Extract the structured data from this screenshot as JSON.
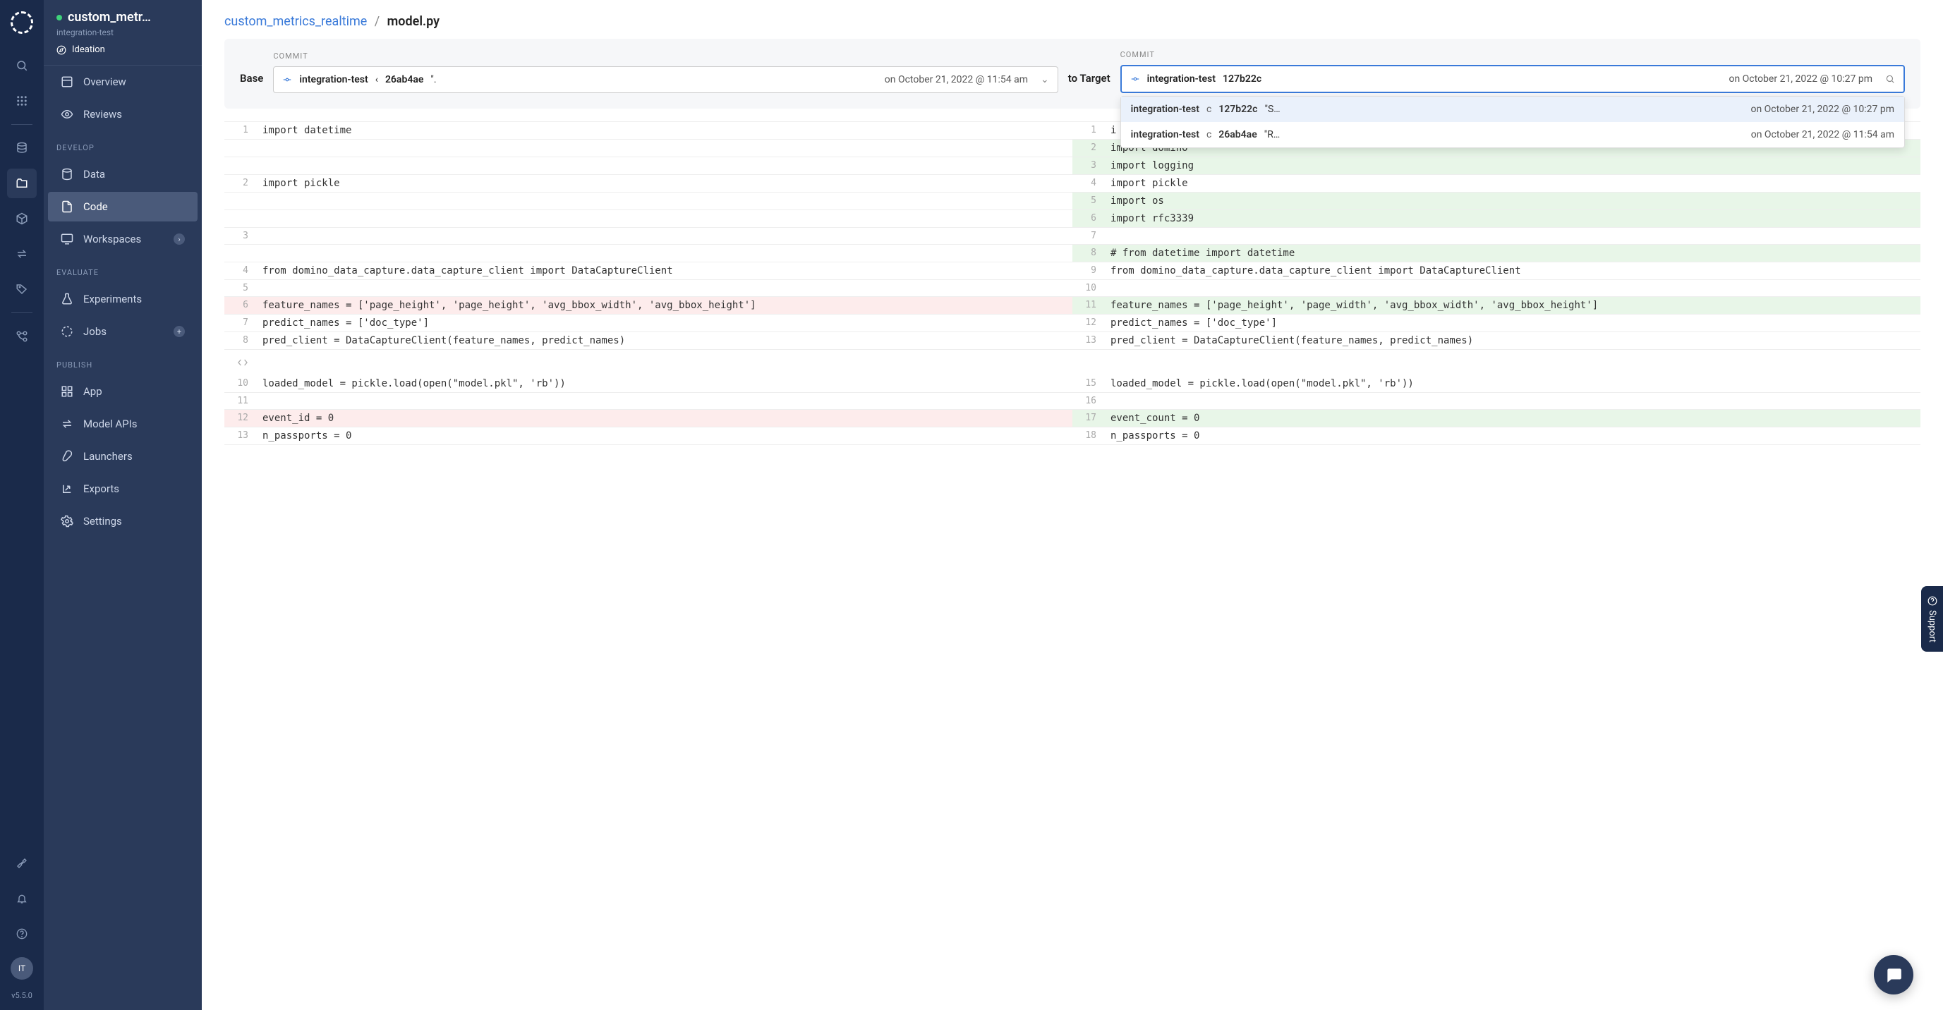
{
  "version": "v5.5.0",
  "avatar_initials": "IT",
  "project": {
    "title": "custom_metr…",
    "subtitle": "integration-test",
    "phase": "Ideation"
  },
  "sidebar": {
    "items": {
      "overview": "Overview",
      "reviews": "Reviews",
      "data": "Data",
      "code": "Code",
      "workspaces": "Workspaces",
      "experiments": "Experiments",
      "jobs": "Jobs",
      "app": "App",
      "model_apis": "Model APIs",
      "launchers": "Launchers",
      "exports": "Exports",
      "settings": "Settings"
    },
    "sections": {
      "develop": "DEVELOP",
      "evaluate": "EVALUATE",
      "publish": "PUBLISH"
    }
  },
  "breadcrumb": {
    "link": "custom_metrics_realtime",
    "sep": "/",
    "current": "model.py"
  },
  "compare": {
    "commit_label": "COMMIT",
    "base_label": "Base",
    "target_label": "to Target",
    "base": {
      "branch": "integration-test",
      "ci": "‹",
      "hash": "26ab4ae",
      "msg": "\".",
      "date": "on October 21, 2022 @ 11:54 am"
    },
    "target": {
      "branch": "integration-test",
      "hash": "127b22c",
      "date": "on October 21, 2022 @ 10:27 pm"
    },
    "dropdown": [
      {
        "branch": "integration-test",
        "ci": "c",
        "hash": "127b22c",
        "msg": "\"S…",
        "date": "on October 21, 2022 @ 10:27 pm"
      },
      {
        "branch": "integration-test",
        "ci": "c",
        "hash": "26ab4ae",
        "msg": "\"R…",
        "date": "on October 21, 2022 @ 11:54 am"
      }
    ]
  },
  "diff": [
    {
      "leftNum": "1",
      "leftCode": "import datetime",
      "rightNum": "1",
      "rightCode": "i",
      "type": "context"
    },
    {
      "leftNum": "",
      "leftCode": "",
      "rightNum": "2",
      "rightCode": "import domino",
      "type": "added"
    },
    {
      "leftNum": "",
      "leftCode": "",
      "rightNum": "3",
      "rightCode": "import logging",
      "type": "added"
    },
    {
      "leftNum": "2",
      "leftCode": "import pickle",
      "rightNum": "4",
      "rightCode": "import pickle",
      "type": "context"
    },
    {
      "leftNum": "",
      "leftCode": "",
      "rightNum": "5",
      "rightCode": "import os",
      "type": "added"
    },
    {
      "leftNum": "",
      "leftCode": "",
      "rightNum": "6",
      "rightCode": "import rfc3339",
      "type": "added"
    },
    {
      "leftNum": "3",
      "leftCode": "",
      "rightNum": "7",
      "rightCode": "",
      "type": "context"
    },
    {
      "leftNum": "",
      "leftCode": "",
      "rightNum": "8",
      "rightCode": "# from datetime import datetime",
      "type": "added"
    },
    {
      "leftNum": "4",
      "leftCode": "from domino_data_capture.data_capture_client import DataCaptureClient",
      "rightNum": "9",
      "rightCode": "from domino_data_capture.data_capture_client import DataCaptureClient",
      "type": "context"
    },
    {
      "leftNum": "5",
      "leftCode": "",
      "rightNum": "10",
      "rightCode": "",
      "type": "context"
    },
    {
      "leftNum": "6",
      "leftCode": "feature_names = ['page_height', 'page_height', 'avg_bbox_width', 'avg_bbox_height']",
      "rightNum": "11",
      "rightCode": "feature_names = ['page_height', 'page_width', 'avg_bbox_width', 'avg_bbox_height']",
      "type": "changed"
    },
    {
      "leftNum": "7",
      "leftCode": "predict_names = ['doc_type']",
      "rightNum": "12",
      "rightCode": "predict_names = ['doc_type']",
      "type": "context"
    },
    {
      "leftNum": "8",
      "leftCode": "pred_client = DataCaptureClient(feature_names, predict_names)",
      "rightNum": "13",
      "rightCode": "pred_client = DataCaptureClient(feature_names, predict_names)",
      "type": "context"
    },
    {
      "type": "expand"
    },
    {
      "leftNum": "10",
      "leftCode": "loaded_model = pickle.load(open(\"model.pkl\", 'rb'))",
      "rightNum": "15",
      "rightCode": "loaded_model = pickle.load(open(\"model.pkl\", 'rb'))",
      "type": "context"
    },
    {
      "leftNum": "11",
      "leftCode": "",
      "rightNum": "16",
      "rightCode": "",
      "type": "context"
    },
    {
      "leftNum": "12",
      "leftCode": "event_id = 0",
      "rightNum": "17",
      "rightCode": "event_count = 0",
      "type": "changed"
    },
    {
      "leftNum": "13",
      "leftCode": "n_passports = 0",
      "rightNum": "18",
      "rightCode": "n_passports = 0",
      "type": "context"
    }
  ],
  "support": "Support"
}
